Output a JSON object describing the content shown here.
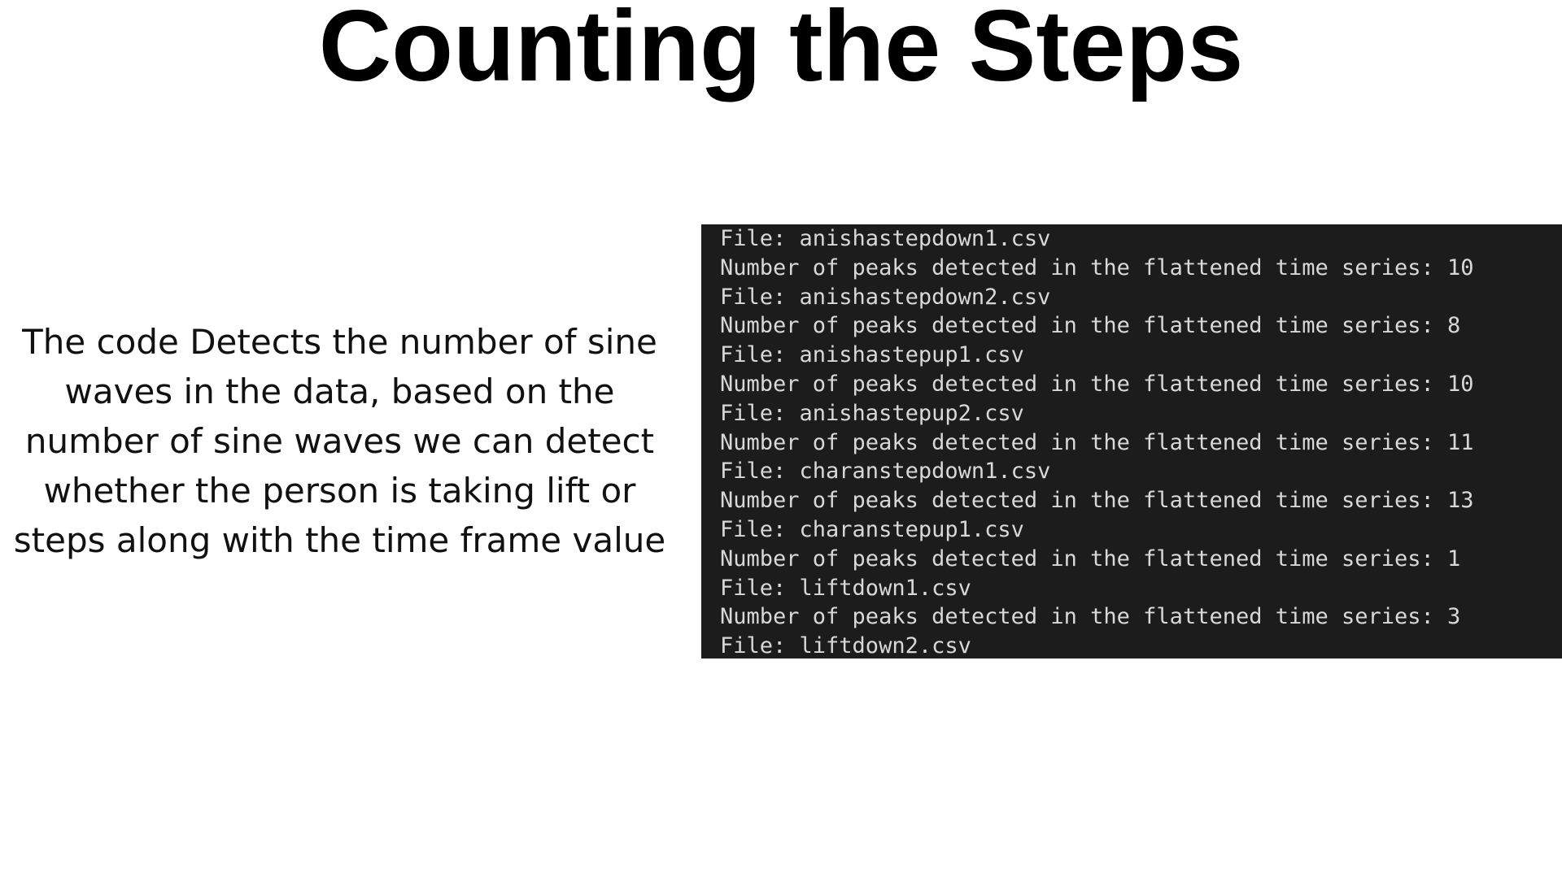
{
  "slide": {
    "title": "Counting the Steps",
    "description": "The code Detects the number of sine waves in the data, based on the number of sine waves we can detect whether the person is taking lift or steps along with the time frame value"
  },
  "terminal": {
    "lines": [
      "File: anishastepdown1.csv",
      "Number of peaks detected in the flattened time series: 10",
      "File: anishastepdown2.csv",
      "Number of peaks detected in the flattened time series: 8",
      "File: anishastepup1.csv",
      "Number of peaks detected in the flattened time series: 10",
      "File: anishastepup2.csv",
      "Number of peaks detected in the flattened time series: 11",
      "File: charanstepdown1.csv",
      "Number of peaks detected in the flattened time series: 13",
      "File: charanstepup1.csv",
      "Number of peaks detected in the flattened time series: 1",
      "File: liftdown1.csv",
      "Number of peaks detected in the flattened time series: 3",
      "File: liftdown2.csv"
    ]
  }
}
